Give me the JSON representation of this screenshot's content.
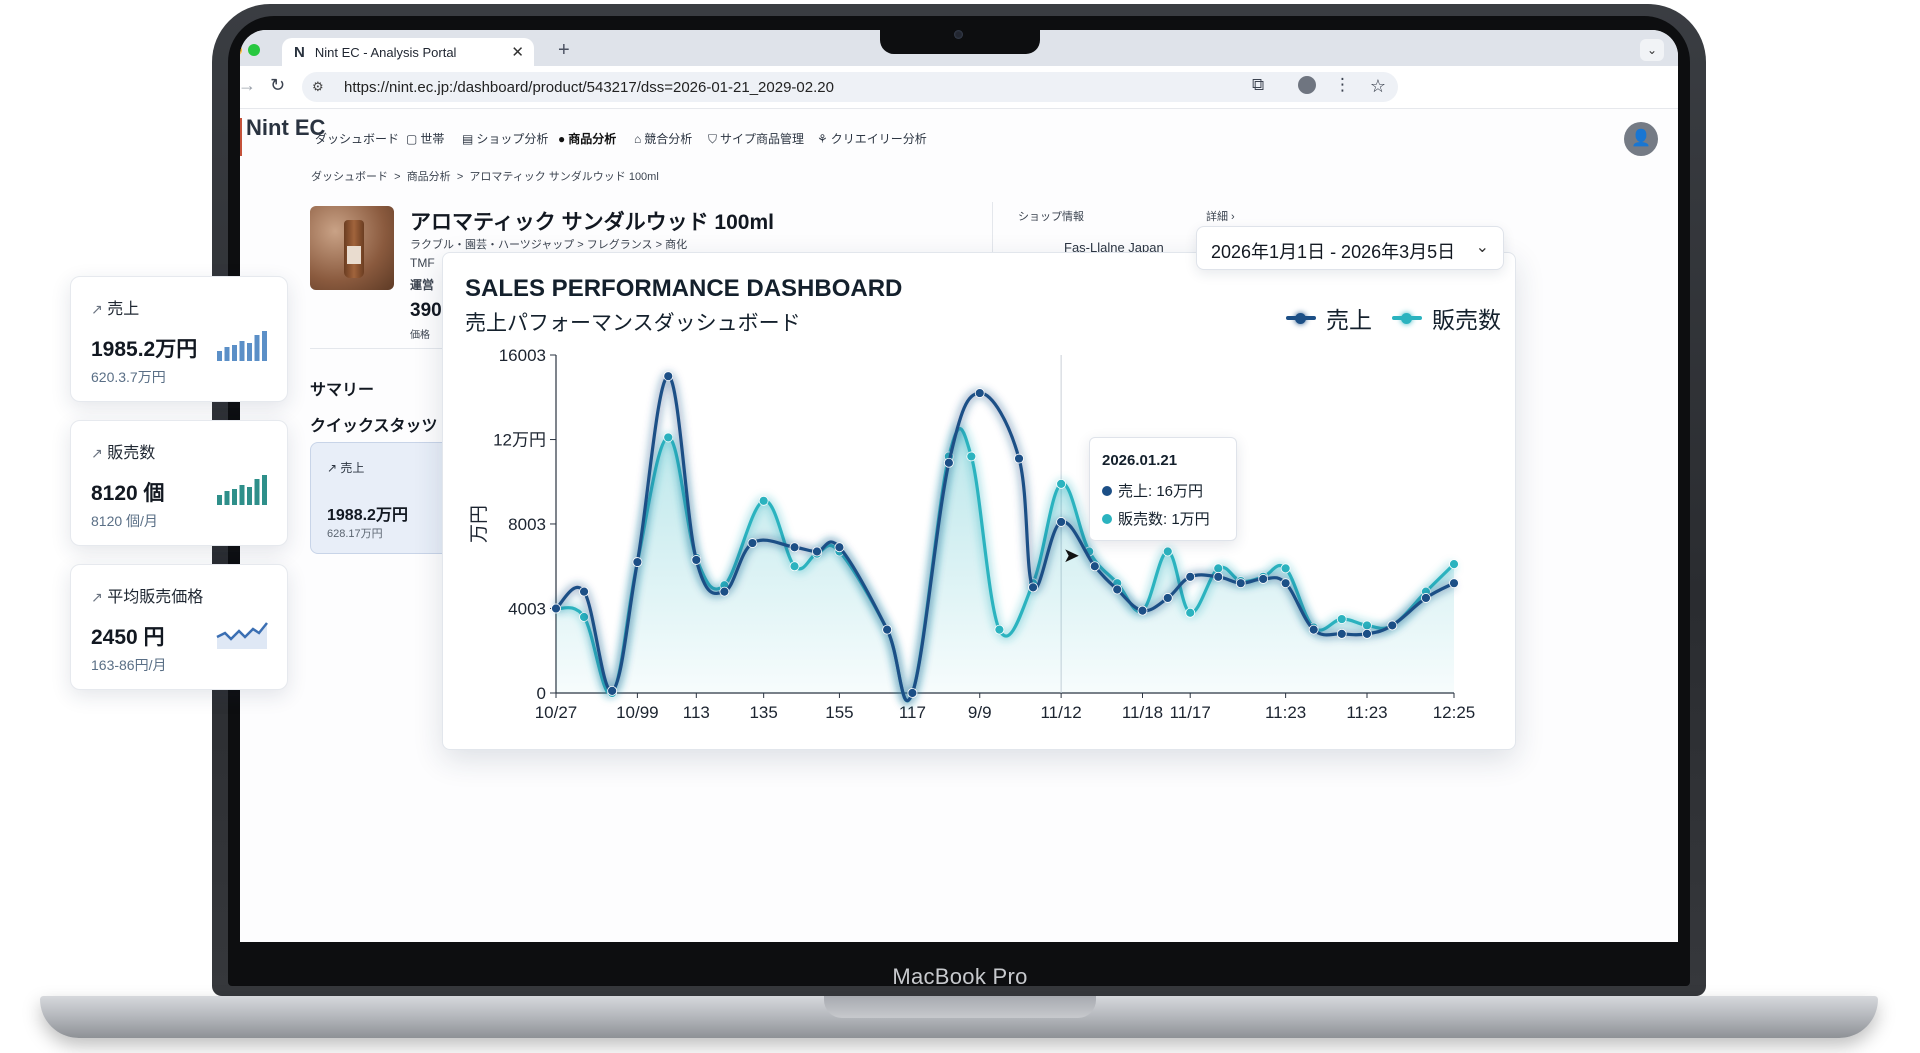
{
  "browser": {
    "tab_title": "Nint EC - Analysis Portal",
    "url": "https://nint.ec.jp:/dashboard/product/543217/dss=2026-01-21_2029-02.20",
    "tab_favicon": "N"
  },
  "app": {
    "logo": "Nint EC",
    "nav": [
      {
        "label": "ダッシュボード",
        "icon": ""
      },
      {
        "label": "世帯",
        "icon": "▢"
      },
      {
        "label": "ショップ分析",
        "icon": "▤"
      },
      {
        "label": "商品分析",
        "icon": "●"
      },
      {
        "label": "競合分析",
        "icon": "⌂"
      },
      {
        "label": "サイプ商品管理",
        "icon": "⛉"
      },
      {
        "label": "クリエイリー分析",
        "icon": "⚘"
      }
    ],
    "breadcrumb": [
      "ダッシュボード",
      "商品分析",
      "アロマティック サンダルウッド 100ml"
    ],
    "breadcrumb_sep": ">"
  },
  "product": {
    "title": "アロマティック サンダルウッド 100ml",
    "category": "ラクブル・園芸・ハーツジャップ > フレグランス > 商化",
    "meta1": "TMF",
    "meta2": "運営",
    "price": "390",
    "price_note": "価格"
  },
  "shop_info": {
    "label": "ショップ情報",
    "link": "詳細 ›",
    "name": "Fas-Llalne Japan"
  },
  "summary": {
    "title": "サマリー",
    "quick_title": "クイックスタッツ",
    "card": {
      "label": "売上",
      "value": "1988.2万円",
      "sub": "628.17万円"
    }
  },
  "kpis": [
    {
      "label": "売上",
      "value": "1985.2万円",
      "sub": "620.3.7万円",
      "spark": "bars"
    },
    {
      "label": "販売数",
      "value": "8120 個",
      "sub": "8120 個/月",
      "spark": "bars"
    },
    {
      "label": "平均販売価格",
      "value": "2450 円",
      "sub": "163-86円/月",
      "spark": "line"
    }
  ],
  "kpi_trend_icon": "↗",
  "date_range": "2026年1月1日 - 2026年3月5日",
  "chart": {
    "title": "SALES PERFORMANCE DASHBOARD",
    "subtitle": "売上パフォーマンスダッシュボード",
    "tooltip": {
      "date": "2026.01.21",
      "rows": [
        {
          "label": "売上: 16万円"
        },
        {
          "label": "販売数: 1万円"
        }
      ]
    }
  },
  "chart_data": {
    "type": "line",
    "title": "SALES PERFORMANCE DASHBOARD",
    "subtitle": "売上パフォーマンスダッシュボード",
    "ylabel": "万円",
    "xlabel": "",
    "ylim": [
      0,
      16003
    ],
    "y_ticks": [
      {
        "value": 0,
        "label": "0"
      },
      {
        "value": 4003,
        "label": "4003"
      },
      {
        "value": 8003,
        "label": "8003"
      },
      {
        "value": 12000,
        "label": "12万円"
      },
      {
        "value": 16003,
        "label": "16003"
      }
    ],
    "x_ticks": [
      {
        "x": 0,
        "label": "10/27"
      },
      {
        "x": 2.9,
        "label": "10/99"
      },
      {
        "x": 5.0,
        "label": "113"
      },
      {
        "x": 7.4,
        "label": "135"
      },
      {
        "x": 10.1,
        "label": "155"
      },
      {
        "x": 12.7,
        "label": "117"
      },
      {
        "x": 15.1,
        "label": "9/9"
      },
      {
        "x": 18.0,
        "label": "11/12"
      },
      {
        "x": 20.9,
        "label": "11/18"
      },
      {
        "x": 22.6,
        "label": "11/17"
      },
      {
        "x": 26.0,
        "label": "11:23"
      },
      {
        "x": 28.9,
        "label": "11:23"
      },
      {
        "x": 32.0,
        "label": "12:25"
      }
    ],
    "x_max": 32,
    "hover_x": 18.0,
    "grid": false,
    "legend_position": "top-right",
    "series": [
      {
        "name": "売上",
        "color": "#1c4f86",
        "points": [
          [
            0,
            4000
          ],
          [
            1.0,
            4800
          ],
          [
            2.0,
            100
          ],
          [
            2.9,
            6200
          ],
          [
            4.0,
            15000
          ],
          [
            5.0,
            6300
          ],
          [
            6.0,
            4800
          ],
          [
            7.0,
            7100
          ],
          [
            8.5,
            6900
          ],
          [
            9.3,
            6700
          ],
          [
            10.1,
            6900
          ],
          [
            11.8,
            3000
          ],
          [
            12.7,
            0
          ],
          [
            14.0,
            10900
          ],
          [
            15.1,
            14200
          ],
          [
            16.5,
            11100
          ],
          [
            17.0,
            5000
          ],
          [
            18.0,
            8100
          ],
          [
            19.2,
            6000
          ],
          [
            20.0,
            4900
          ],
          [
            20.9,
            3900
          ],
          [
            21.8,
            4500
          ],
          [
            22.6,
            5500
          ],
          [
            23.6,
            5500
          ],
          [
            24.4,
            5200
          ],
          [
            25.2,
            5400
          ],
          [
            26.0,
            5200
          ],
          [
            27.0,
            3000
          ],
          [
            28.0,
            2800
          ],
          [
            28.9,
            2800
          ],
          [
            29.8,
            3200
          ],
          [
            31.0,
            4500
          ],
          [
            32.0,
            5200
          ]
        ]
      },
      {
        "name": "販売数",
        "color": "#2bb3bf",
        "points": [
          [
            0,
            4000
          ],
          [
            1.0,
            3600
          ],
          [
            2.0,
            0
          ],
          [
            2.9,
            6200
          ],
          [
            4.0,
            12100
          ],
          [
            5.0,
            6400
          ],
          [
            6.0,
            5100
          ],
          [
            7.4,
            9100
          ],
          [
            8.5,
            6000
          ],
          [
            9.3,
            6600
          ],
          [
            10.1,
            6700
          ],
          [
            11.8,
            3000
          ],
          [
            12.7,
            0
          ],
          [
            14.0,
            11200
          ],
          [
            14.8,
            11200
          ],
          [
            15.8,
            3000
          ],
          [
            17.0,
            5200
          ],
          [
            18.0,
            9900
          ],
          [
            19.0,
            6700
          ],
          [
            20.0,
            5200
          ],
          [
            20.9,
            3900
          ],
          [
            21.8,
            6700
          ],
          [
            22.6,
            3800
          ],
          [
            23.6,
            5900
          ],
          [
            24.4,
            5300
          ],
          [
            25.2,
            5500
          ],
          [
            26.0,
            5900
          ],
          [
            27.0,
            3100
          ],
          [
            28.0,
            3500
          ],
          [
            28.9,
            3200
          ],
          [
            29.8,
            3200
          ],
          [
            31.0,
            4800
          ],
          [
            32.0,
            6100
          ]
        ]
      }
    ]
  }
}
